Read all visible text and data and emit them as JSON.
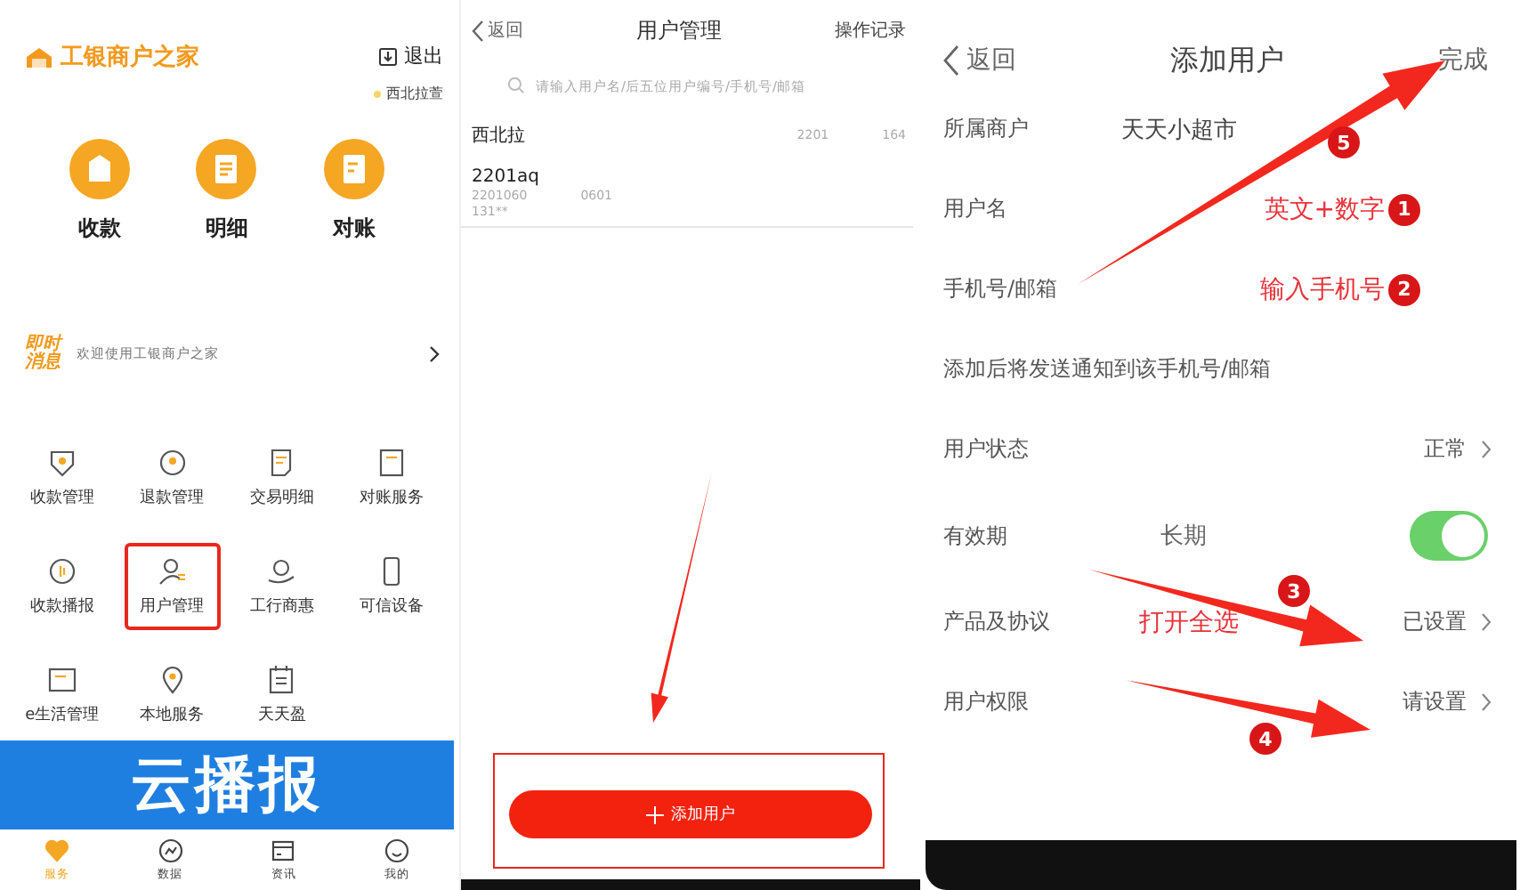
{
  "home": {
    "logo": "工银商户之家",
    "logout": "退出",
    "merchant": "西北拉萱",
    "shortcuts": [
      {
        "label": "收款"
      },
      {
        "label": "明细"
      },
      {
        "label": "对账"
      }
    ],
    "news": {
      "badge": "即时消息",
      "text": "欢迎使用工银商户之家"
    },
    "services": [
      {
        "label": "收款管理",
        "highlighted": false
      },
      {
        "label": "退款管理",
        "highlighted": false
      },
      {
        "label": "交易明细",
        "highlighted": false
      },
      {
        "label": "对账服务",
        "highlighted": false
      },
      {
        "label": "收款播报",
        "highlighted": false
      },
      {
        "label": "用户管理",
        "highlighted": true
      },
      {
        "label": "工行商惠",
        "highlighted": false
      },
      {
        "label": "可信设备",
        "highlighted": false
      },
      {
        "label": "e生活管理",
        "highlighted": false
      },
      {
        "label": "本地服务",
        "highlighted": false
      },
      {
        "label": "天天盈",
        "highlighted": false
      }
    ],
    "banner": "云播报",
    "tabs": [
      {
        "label": "服务",
        "selected": true
      },
      {
        "label": "数据",
        "selected": false
      },
      {
        "label": "资讯",
        "selected": false
      },
      {
        "label": "我的",
        "selected": false
      }
    ]
  },
  "user_management": {
    "back": "返回",
    "title": "用户管理",
    "action": "操作记录",
    "search": {
      "placeholder": "请输入用户名/后五位用户编号/手机号/邮箱"
    },
    "users": [
      {
        "kind": "single",
        "name": "西北拉",
        "code_start": "2201",
        "code_end": "164"
      },
      {
        "kind": "detailed",
        "name": "2201aq",
        "code_start": "2201060",
        "code_end": "0601",
        "phone": "131**"
      }
    ],
    "add_button": {
      "label": "添加用户",
      "highlighted": true
    }
  },
  "add_user": {
    "back": "返回",
    "title": "添加用户",
    "done": "完成",
    "fields": [
      {
        "kind": "value",
        "label": "所属商户",
        "value": "天天小超市"
      },
      {
        "kind": "input",
        "label": "用户名",
        "annotation": "英文+数字",
        "step": "1"
      },
      {
        "kind": "input",
        "label": "手机号/邮箱",
        "annotation": "输入手机号",
        "step": "2"
      },
      {
        "kind": "note",
        "text": "添加后将发送通知到该手机号/邮箱"
      },
      {
        "kind": "link",
        "label": "用户状态",
        "value": "正常"
      },
      {
        "kind": "toggle",
        "label": "有效期",
        "value": "长期",
        "on": true
      },
      {
        "kind": "link",
        "label": "产品及协议",
        "value": "已设置",
        "annotation": "打开全选"
      },
      {
        "kind": "link",
        "label": "用户权限",
        "value": "请设置"
      }
    ],
    "step_badges": [
      "5",
      "3",
      "4"
    ]
  }
}
